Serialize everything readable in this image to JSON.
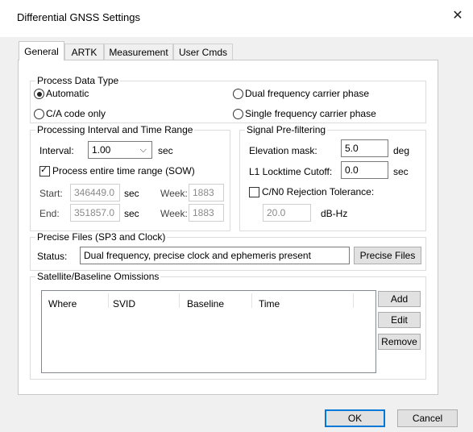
{
  "window": {
    "title": "Differential GNSS Settings",
    "close_glyph": "✕"
  },
  "tabs": [
    "General",
    "ARTK",
    "Measurement",
    "User Cmds"
  ],
  "process_data_type": {
    "label": "Process Data Type",
    "options": [
      "Automatic",
      "C/A code only",
      "Dual frequency carrier phase",
      "Single frequency carrier phase"
    ],
    "selected": "Automatic"
  },
  "processing": {
    "label": "Processing Interval and Time Range",
    "interval_label": "Interval:",
    "interval_value": "1.00",
    "interval_unit": "sec",
    "entire_range_label": "Process entire time range (SOW)",
    "entire_range_checked": true,
    "start_label": "Start:",
    "start_value": "346449.0",
    "start_unit": "sec",
    "start_week_label": "Week:",
    "start_week": "1883",
    "end_label": "End:",
    "end_value": "351857.0",
    "end_unit": "sec",
    "end_week_label": "Week:",
    "end_week": "1883"
  },
  "prefilter": {
    "label": "Signal Pre-filtering",
    "elev_label": "Elevation mask:",
    "elev_value": "5.0",
    "elev_unit": "deg",
    "locktime_label": "L1 Locktime Cutoff:",
    "locktime_value": "0.0",
    "locktime_unit": "sec",
    "cn0_label": "C/N0 Rejection Tolerance:",
    "cn0_checked": false,
    "cn0_value": "20.0",
    "cn0_unit": "dB-Hz"
  },
  "precise": {
    "label": "Precise Files (SP3 and Clock)",
    "status_label": "Status:",
    "status_value": "Dual frequency, precise clock and ephemeris present",
    "button": "Precise Files"
  },
  "omissions": {
    "label": "Satellite/Baseline Omissions",
    "columns": [
      "Where",
      "SVID",
      "Baseline",
      "Time"
    ],
    "buttons": [
      "Add",
      "Edit",
      "Remove"
    ]
  },
  "footer": {
    "ok": "OK",
    "cancel": "Cancel"
  }
}
